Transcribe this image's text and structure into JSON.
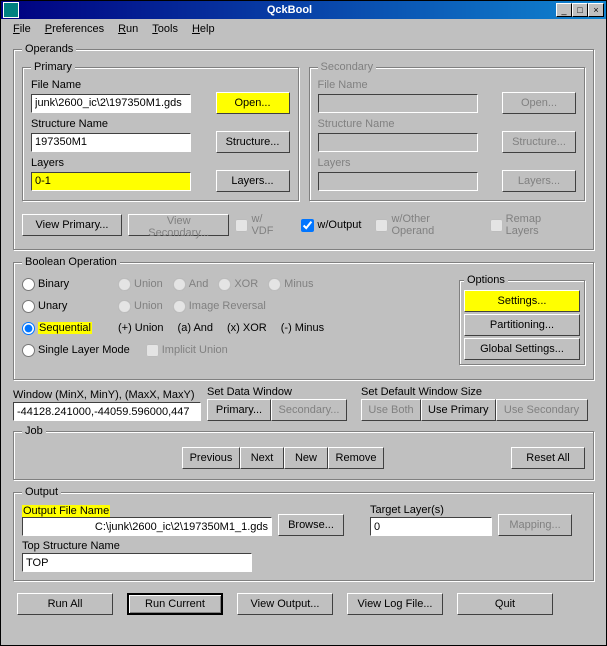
{
  "title": "QckBool",
  "menu": {
    "file": "File",
    "preferences": "Preferences",
    "run": "Run",
    "tools": "Tools",
    "help": "Help"
  },
  "operands": {
    "legend": "Operands",
    "primary": {
      "legend": "Primary",
      "fileNameLabel": "File Name",
      "fileName": "junk\\2600_ic\\2\\197350M1.gds",
      "open": "Open...",
      "structNameLabel": "Structure Name",
      "structName": "197350M1",
      "structure": "Structure...",
      "layersLabel": "Layers",
      "layers": "0-1",
      "layersBtn": "Layers..."
    },
    "secondary": {
      "legend": "Secondary",
      "fileNameLabel": "File Name",
      "open": "Open...",
      "structNameLabel": "Structure Name",
      "structure": "Structure...",
      "layersLabel": "Layers",
      "layersBtn": "Layers..."
    },
    "viewPrimary": "View Primary...",
    "viewSecondary": "View Secondary...",
    "wVDF": "w/ VDF",
    "wOutput": "w/Output",
    "wOther": "w/Other Operand",
    "remap": "Remap Layers"
  },
  "boolop": {
    "legend": "Boolean Operation",
    "binary": "Binary",
    "unary": "Unary",
    "sequential": "Sequential",
    "single": "Single Layer Mode",
    "union": "Union",
    "and": "And",
    "xor": "XOR",
    "minus": "Minus",
    "imgrev": "Image Reversal",
    "seqUnion": "(+) Union",
    "seqAnd": "(a) And",
    "seqXor": "(x) XOR",
    "seqMinus": "(-) Minus",
    "implicit": "Implicit Union",
    "options": {
      "legend": "Options",
      "settings": "Settings...",
      "partitioning": "Partitioning...",
      "global": "Global Settings..."
    }
  },
  "window": {
    "label": "Window (MinX, MinY), (MaxX, MaxY)",
    "value": "-44128.241000,-44059.596000,447",
    "setData": "Set Data Window",
    "primary": "Primary...",
    "secondary": "Secondary...",
    "setDefault": "Set Default Window Size",
    "useBoth": "Use Both",
    "usePrimary": "Use Primary",
    "useSecondary": "Use Secondary"
  },
  "job": {
    "legend": "Job",
    "previous": "Previous",
    "next": "Next",
    "new": "New",
    "remove": "Remove",
    "reset": "Reset All"
  },
  "output": {
    "legend": "Output",
    "fileNameLabel": "Output File Name",
    "fileName": "C:\\junk\\2600_ic\\2\\197350M1_1.gds",
    "browse": "Browse...",
    "targetLabel": "Target Layer(s)",
    "target": "0",
    "mapping": "Mapping...",
    "topStructLabel": "Top Structure Name",
    "topStruct": "TOP"
  },
  "bottom": {
    "runAll": "Run All",
    "runCurrent": "Run Current",
    "viewOutput": "View Output...",
    "viewLog": "View Log File...",
    "quit": "Quit"
  }
}
